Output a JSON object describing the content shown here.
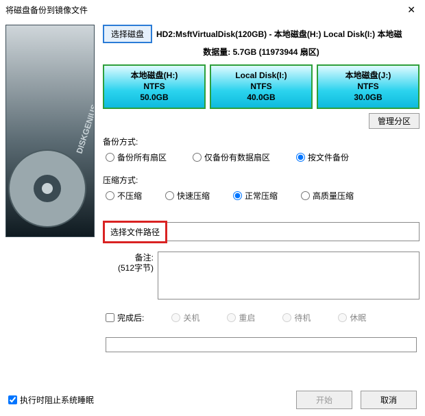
{
  "window": {
    "title": "将磁盘备份到镜像文件",
    "close": "✕"
  },
  "disk": {
    "select_btn": "选择磁盘",
    "info": "HD2:MsftVirtualDisk(120GB) - 本地磁盘(H:) Local Disk(I:) 本地磁",
    "data_size_label": "数据量:",
    "data_size_value": "5.7GB (11973944 扇区)"
  },
  "partitions": [
    {
      "name": "本地磁盘(H:)",
      "fs": "NTFS",
      "size": "50.0GB"
    },
    {
      "name": "Local Disk(I:)",
      "fs": "NTFS",
      "size": "40.0GB"
    },
    {
      "name": "本地磁盘(J:)",
      "fs": "NTFS",
      "size": "30.0GB"
    }
  ],
  "buttons": {
    "manage_partitions": "管理分区"
  },
  "backup": {
    "label": "备份方式:",
    "options": [
      "备份所有扇区",
      "仅备份有数据扇区",
      "按文件备份"
    ],
    "selected": 2
  },
  "compress": {
    "label": "压缩方式:",
    "options": [
      "不压缩",
      "快速压缩",
      "正常压缩",
      "高质量压缩"
    ],
    "selected": 2
  },
  "path": {
    "button": "选择文件路径",
    "value": ""
  },
  "remark": {
    "label": "备注:",
    "sub": "(512字节)",
    "value": ""
  },
  "after": {
    "checkbox": "完成后:",
    "checked": false,
    "options": [
      "关机",
      "重启",
      "待机",
      "休眠"
    ]
  },
  "footer": {
    "sleep_label": "执行时阻止系统睡眠",
    "sleep_checked": true,
    "start": "开始",
    "cancel": "取消"
  }
}
